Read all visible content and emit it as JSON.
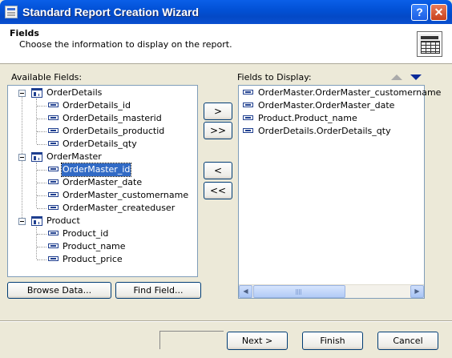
{
  "window": {
    "title": "Standard Report Creation Wizard",
    "help_label": "?",
    "close_label": "✕"
  },
  "header": {
    "title": "Fields",
    "subtitle": "Choose the information to display on the report."
  },
  "available": {
    "label": "Available Fields:",
    "groups": [
      {
        "name": "OrderDetails",
        "fields": [
          "OrderDetails_id",
          "OrderDetails_masterid",
          "OrderDetails_productid",
          "OrderDetails_qty"
        ]
      },
      {
        "name": "OrderMaster",
        "fields": [
          "OrderMaster_id",
          "OrderMaster_date",
          "OrderMaster_customername",
          "OrderMaster_createduser"
        ]
      },
      {
        "name": "Product",
        "fields": [
          "Product_id",
          "Product_name",
          "Product_price"
        ]
      }
    ],
    "selected_field": "OrderMaster_id"
  },
  "move_buttons": {
    "add": ">",
    "add_all": ">>",
    "remove": "<",
    "remove_all": "<<"
  },
  "display": {
    "label": "Fields to Display:",
    "fields": [
      "OrderMaster.OrderMaster_customername",
      "OrderMaster.OrderMaster_date",
      "Product.Product_name",
      "OrderDetails.OrderDetails_qty"
    ]
  },
  "actions": {
    "browse": "Browse Data...",
    "find": "Find Field...",
    "next": "Next >",
    "finish": "Finish",
    "cancel": "Cancel"
  },
  "colors": {
    "title_bar": "#0251d6",
    "selection": "#316ac5",
    "dialog_bg": "#ece9d8"
  }
}
